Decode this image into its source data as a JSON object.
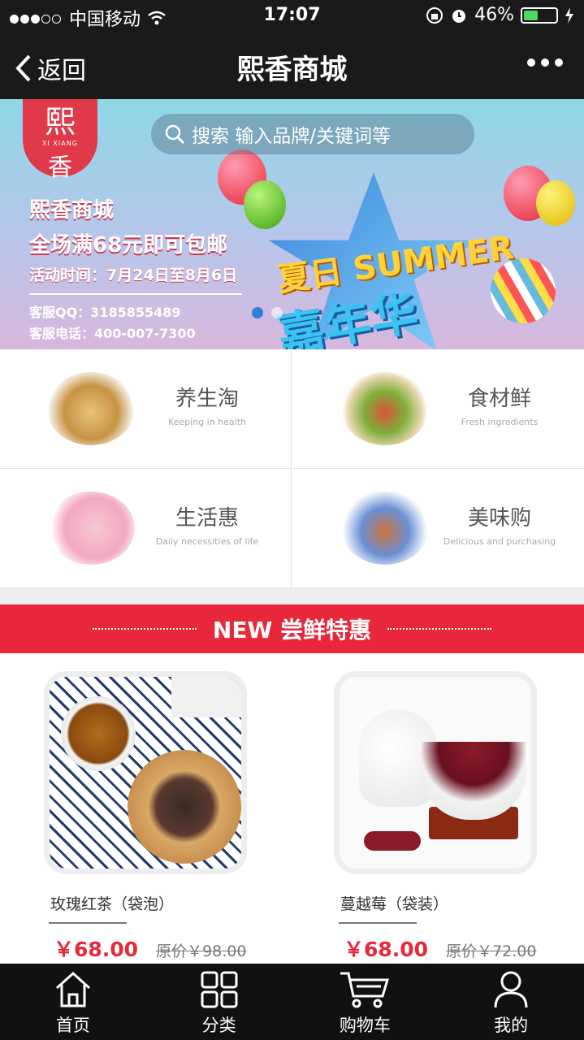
{
  "status_bar": {
    "carrier": "中国移动",
    "time": "17:07",
    "battery_percent": "46%",
    "battery_level": 0.46
  },
  "nav": {
    "back_label": "返回",
    "title": "熙香商城"
  },
  "banner": {
    "logo_char1": "熙",
    "logo_en": "XI XIANG",
    "logo_char2": "香",
    "search_placeholder": "搜索 输入品牌/关键词等",
    "promo_line1": "熙香商城",
    "promo_line2": "全场满68元即可包邮",
    "promo_line3": "活动时间：7月24日至8月6日",
    "qq_line": "客服QQ：3185855489",
    "phone_line": "客服电话：400-007-7300",
    "summer_word1": "夏日 SUMMER",
    "summer_word2": "嘉年华",
    "slide_count": 2,
    "active_slide": 0
  },
  "categories": [
    {
      "name": "养生淘",
      "en": "Keeping in health"
    },
    {
      "name": "食材鲜",
      "en": "Fresh ingredients"
    },
    {
      "name": "生活惠",
      "en": "Daily necessities of life"
    },
    {
      "name": "美味购",
      "en": "Delicious and purchasing"
    }
  ],
  "section": {
    "title": "NEW 尝鲜特惠"
  },
  "products": [
    {
      "name": "玫瑰红茶（袋泡）",
      "price": "￥68.00",
      "original": "原价￥98.00"
    },
    {
      "name": "蔓越莓（袋装）",
      "price": "￥68.00",
      "original": "原价￥72.00"
    }
  ],
  "tabbar": [
    {
      "label": "首页",
      "icon": "home-icon"
    },
    {
      "label": "分类",
      "icon": "category-icon"
    },
    {
      "label": "购物车",
      "icon": "cart-icon"
    },
    {
      "label": "我的",
      "icon": "user-icon"
    }
  ],
  "colors": {
    "accent_red": "#e8283a",
    "dark_bar": "#1a1a1a",
    "battery_green": "#4cd964"
  }
}
